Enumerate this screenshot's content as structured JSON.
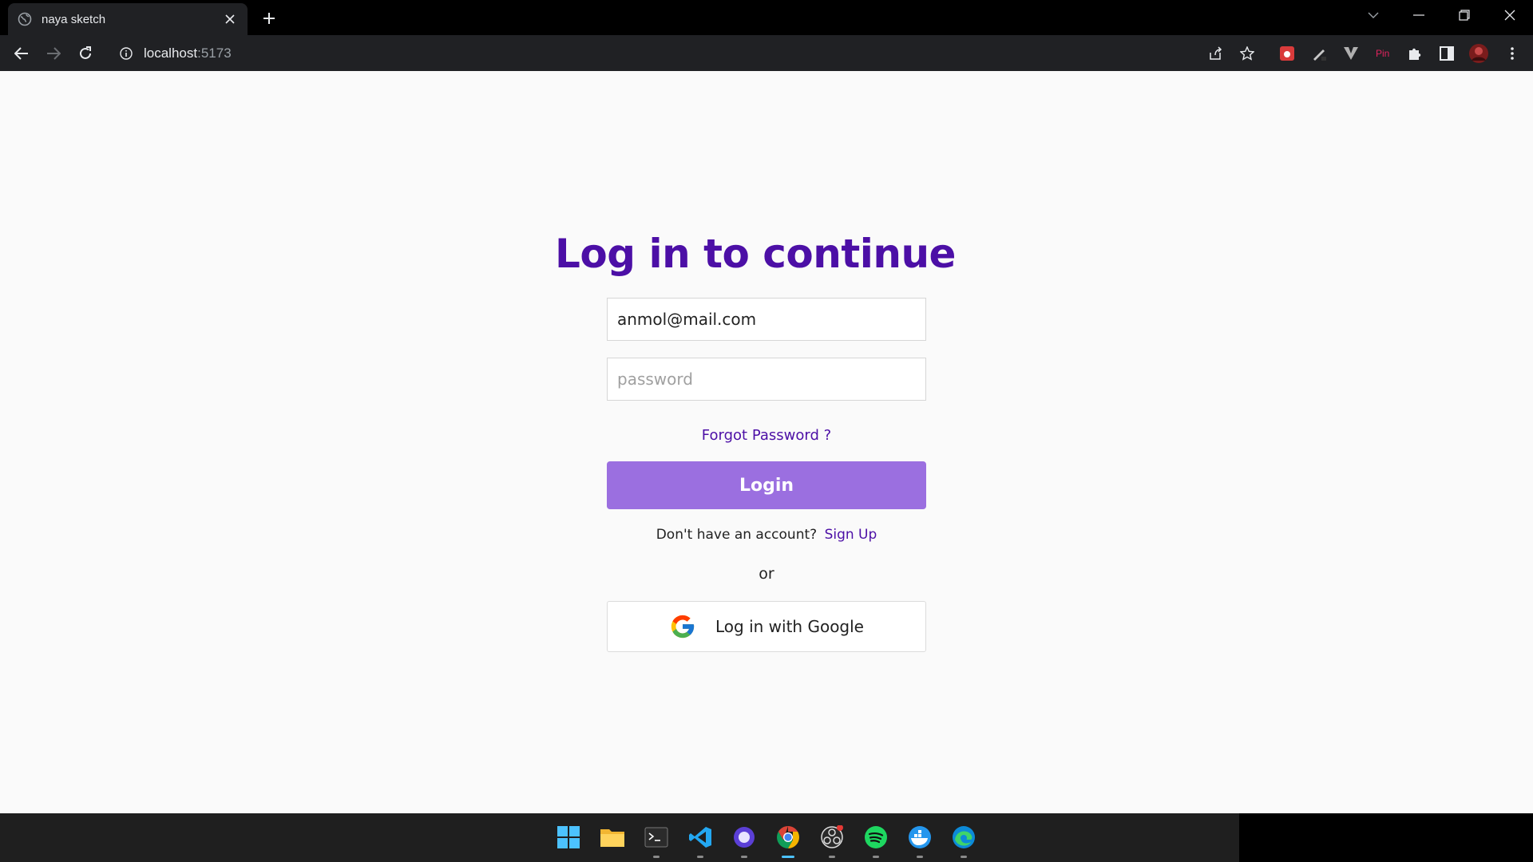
{
  "browser": {
    "tab_title": "naya sketch",
    "url_host": "localhost",
    "url_port": ":5173"
  },
  "page": {
    "heading": "Log in to continue",
    "email_value": "anmol@mail.com",
    "password_placeholder": "password",
    "forgot_label": "Forgot Password ?",
    "login_label": "Login",
    "no_account_text": "Don't have an account?",
    "signup_label": "Sign Up",
    "or_text": "or",
    "google_label": "Log in with Google"
  },
  "colors": {
    "accent": "#4c0fa6",
    "login_button": "#9b6fe0"
  },
  "taskbar": {
    "apps": [
      "windows-start-icon",
      "file-explorer-icon",
      "terminal-icon",
      "vscode-icon",
      "browser-app-icon",
      "chrome-icon",
      "obs-icon",
      "spotify-icon",
      "docker-icon",
      "edge-icon"
    ]
  }
}
